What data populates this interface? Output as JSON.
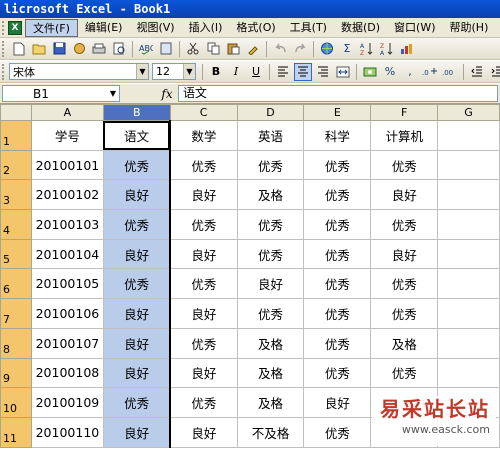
{
  "window": {
    "title": "licrosoft Excel - Book1"
  },
  "menubar": {
    "items": [
      {
        "label": "文件(F)",
        "active": true
      },
      {
        "label": "编辑(E)"
      },
      {
        "label": "视图(V)"
      },
      {
        "label": "插入(I)"
      },
      {
        "label": "格式(O)"
      },
      {
        "label": "工具(T)"
      },
      {
        "label": "数据(D)"
      },
      {
        "label": "窗口(W)"
      },
      {
        "label": "帮助(H)"
      }
    ]
  },
  "format_toolbar": {
    "font_name": "宋体",
    "font_size": "12",
    "bold": "B",
    "italic": "I",
    "underline": "U",
    "percent": "%",
    "comma": ","
  },
  "standard_toolbar": {
    "sigma": "Σ"
  },
  "formula_bar": {
    "name_box": "B1",
    "fx": "fx",
    "formula": "语文"
  },
  "sheet": {
    "columns": [
      "A",
      "B",
      "C",
      "D",
      "E",
      "F",
      "G"
    ],
    "row_numbers": [
      "1",
      "2",
      "3",
      "4",
      "5",
      "6",
      "7",
      "8",
      "9",
      "10",
      "11"
    ],
    "rows": [
      [
        "学号",
        "语文",
        "数学",
        "英语",
        "科学",
        "计算机",
        ""
      ],
      [
        "20100101",
        "优秀",
        "优秀",
        "优秀",
        "优秀",
        "优秀",
        ""
      ],
      [
        "20100102",
        "良好",
        "良好",
        "及格",
        "优秀",
        "良好",
        ""
      ],
      [
        "20100103",
        "优秀",
        "优秀",
        "优秀",
        "优秀",
        "优秀",
        ""
      ],
      [
        "20100104",
        "良好",
        "良好",
        "优秀",
        "优秀",
        "良好",
        ""
      ],
      [
        "20100105",
        "优秀",
        "优秀",
        "良好",
        "优秀",
        "优秀",
        ""
      ],
      [
        "20100106",
        "良好",
        "良好",
        "优秀",
        "优秀",
        "优秀",
        ""
      ],
      [
        "20100107",
        "良好",
        "优秀",
        "及格",
        "优秀",
        "及格",
        ""
      ],
      [
        "20100108",
        "良好",
        "良好",
        "及格",
        "优秀",
        "优秀",
        ""
      ],
      [
        "20100109",
        "优秀",
        "优秀",
        "及格",
        "良好",
        "",
        ""
      ],
      [
        "20100110",
        "良好",
        "良好",
        "不及格",
        "优秀",
        "",
        ""
      ]
    ],
    "selected_column": "B"
  },
  "watermark": {
    "title": "易采站长站",
    "url": "www.easck.com"
  }
}
